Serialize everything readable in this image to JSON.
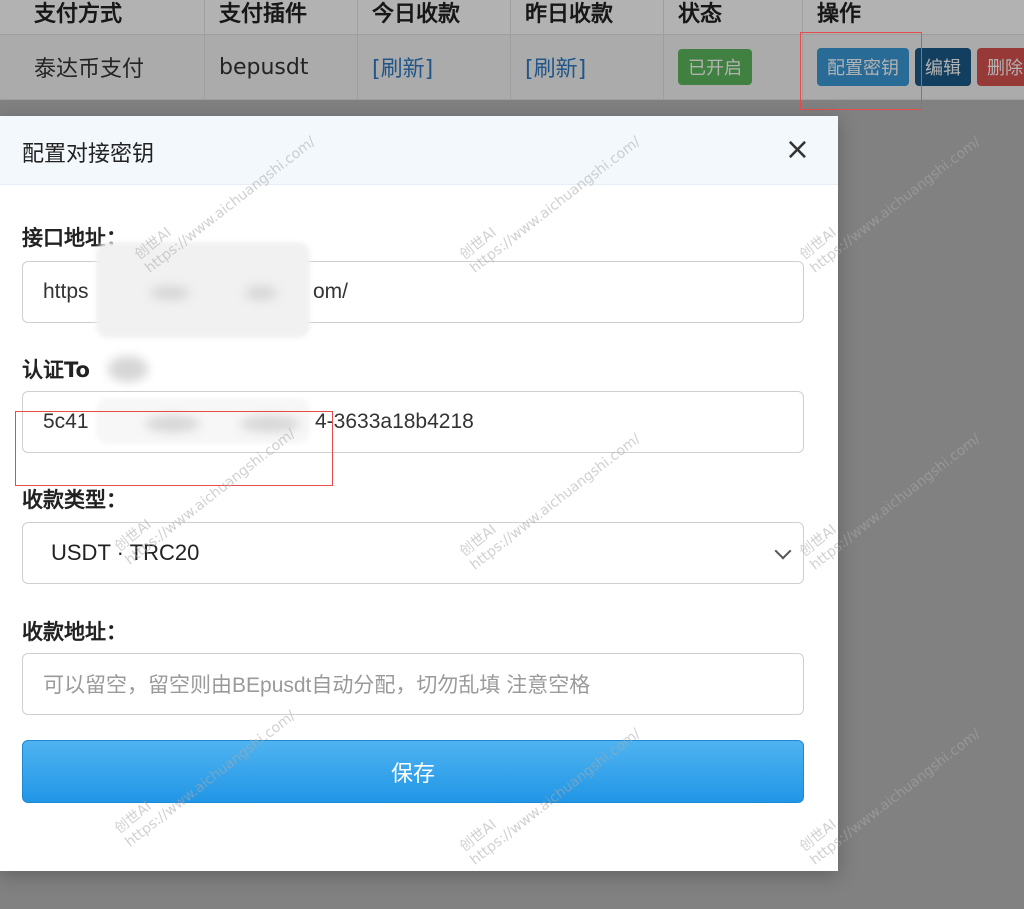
{
  "table": {
    "headers": [
      "支付方式",
      "支付插件",
      "今日收款",
      "昨日收款",
      "状态",
      "操作"
    ],
    "row": {
      "method": "泰达币支付",
      "plugin": "bepusdt",
      "today": "[刷新]",
      "yesterday": "[刷新]",
      "status": "已开启",
      "actions": {
        "configure_key": "配置密钥",
        "edit": "编辑",
        "delete": "删除"
      }
    }
  },
  "modal": {
    "title": "配置对接密钥",
    "close_glyph": "×",
    "fields": {
      "api_address": {
        "label": "接口地址：",
        "value_visible_start": "https",
        "value_visible_end": "om/"
      },
      "auth_token": {
        "label": "认证To",
        "value_visible_start": "5c41",
        "value_visible_end": "4-3633a18b4218"
      },
      "payment_type": {
        "label": "收款类型：",
        "selected": "USDT · TRC20"
      },
      "receive_address": {
        "label": "收款地址：",
        "placeholder": "可以留空，留空则由BEpusdt自动分配，切勿乱填 注意空格"
      }
    },
    "save_label": "保存"
  },
  "watermark": {
    "line1": "创世AI",
    "line2": "https://www.aichuangshi.com/"
  },
  "colors": {
    "highlight_box": "#e74c4c",
    "primary_button": "#2196e6",
    "status_on": "#5cb85c",
    "link": "#2f7cc4"
  }
}
